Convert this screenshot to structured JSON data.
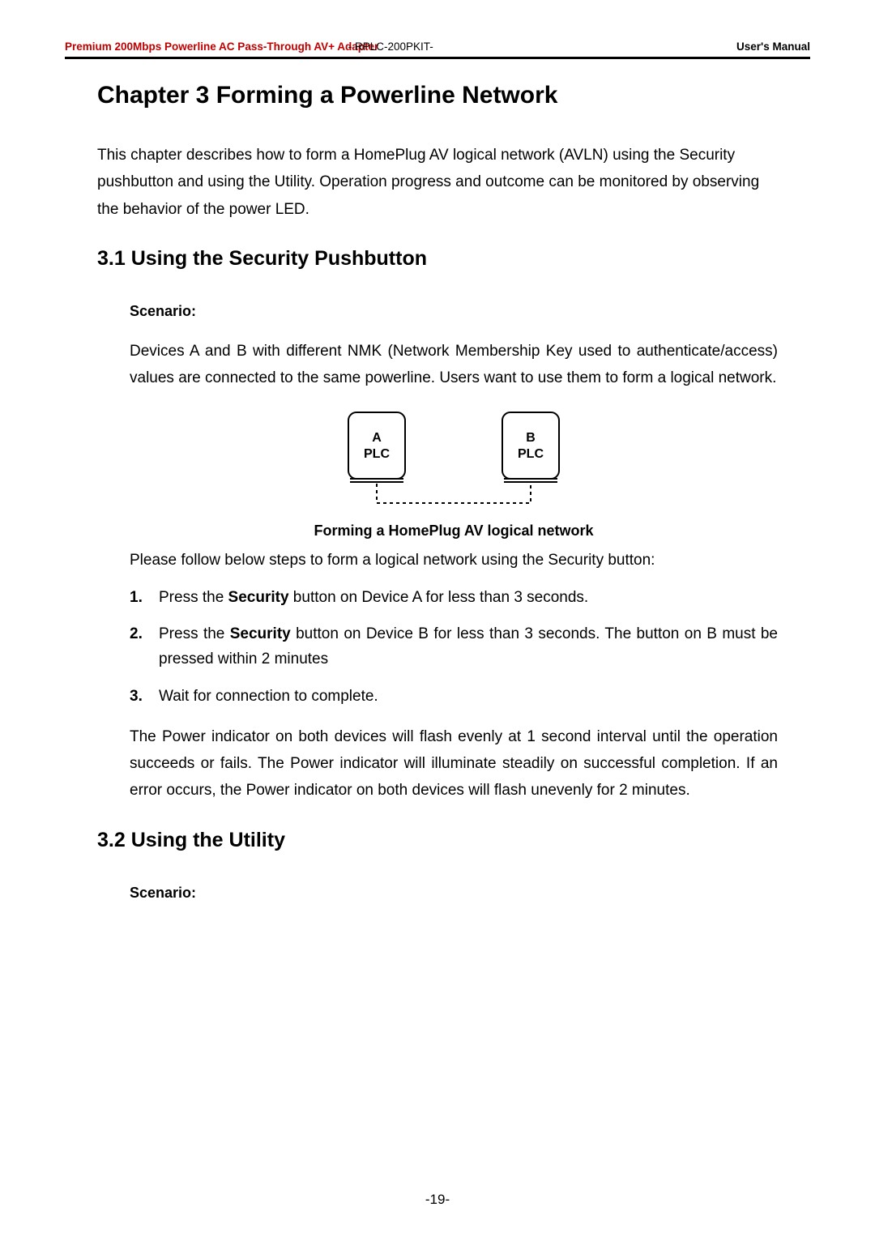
{
  "header": {
    "product_left": "Premium 200Mbps Powerline AC Pass-Through AV+ Adapter",
    "product_mid": "- RPLC-200PKIT-",
    "right": "User's Manual"
  },
  "chapter": {
    "title": "Chapter 3 Forming a Powerline Network",
    "intro": "This chapter describes how to form a HomePlug AV logical network (AVLN) using the Security pushbutton and using the Utility. Operation progress and outcome can be monitored by observing the behavior of the power LED."
  },
  "section31": {
    "title": "3.1 Using the Security Pushbutton",
    "scenario_label": "Scenario:",
    "scenario_text": "Devices A and B with different NMK (Network Membership Key used to authenticate/access) values are connected to the same powerline. Users want to use them to form a logical network.",
    "diagram": {
      "left_label1": "A",
      "left_label2": "PLC",
      "right_label1": "B",
      "right_label2": "PLC"
    },
    "caption": "Forming a HomePlug AV logical network",
    "steps_intro": "Please follow below steps to form a logical network using the Security button:",
    "steps": [
      {
        "num": "1.",
        "pre": "Press the ",
        "bold": "Security",
        "post": " button on Device A for less than 3 seconds."
      },
      {
        "num": "2.",
        "pre": "Press the ",
        "bold": "Security",
        "post": " button on Device B for less than 3 seconds. The button on B must be pressed within 2 minutes"
      },
      {
        "num": "3.",
        "pre": "",
        "bold": "",
        "post": "Wait for connection to complete."
      }
    ],
    "outcome": "The Power indicator on both devices will flash evenly at 1 second interval until the operation succeeds or fails. The Power indicator will illuminate steadily on successful completion. If an error occurs, the Power indicator on both devices will flash unevenly for 2 minutes."
  },
  "section32": {
    "title": "3.2 Using the Utility",
    "scenario_label": "Scenario:"
  },
  "page_number": "-19-"
}
